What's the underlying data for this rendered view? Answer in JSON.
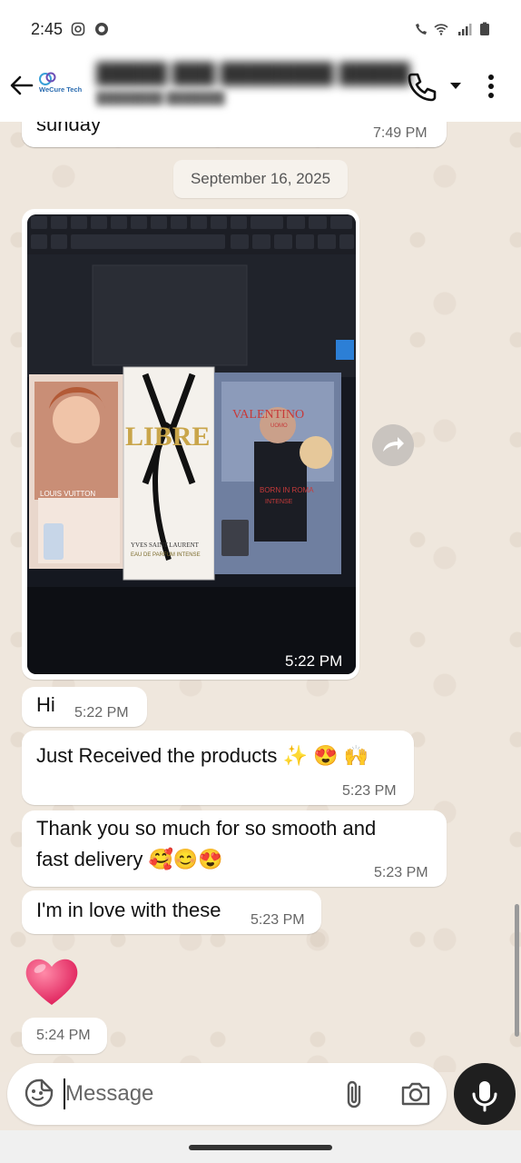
{
  "status_bar": {
    "time": "2:45"
  },
  "header": {
    "avatar_logo_text": "WeCure Tech",
    "contact_name": "█████ ███ ████████ █████",
    "contact_subtitle": "████████ ███████"
  },
  "messages": [
    {
      "text": "sunday",
      "time": "7:49 PM"
    },
    {
      "date_separator": "September 16, 2025"
    },
    {
      "type": "photo",
      "time": "5:22 PM",
      "box_labels": [
        "LOUIS VUITTON",
        "LIBRE",
        "YVES SAINT LAURENT",
        "EAU DE PARFUM INTENSE",
        "VALENTINO",
        "UOMO",
        "BORN IN ROMA",
        "INTENSE"
      ]
    },
    {
      "text": "Hi",
      "time": "5:22 PM"
    },
    {
      "text": "Just Received the products ✨ 😍 🙌",
      "time": "5:23 PM"
    },
    {
      "text_line1": "Thank you so much for so smooth and",
      "text_line2": "fast  delivery 🥰😊😍",
      "time": "5:23 PM"
    },
    {
      "text": "I'm in love with these",
      "time": "5:23 PM"
    },
    {
      "emoji": "heart",
      "time": "5:24 PM"
    }
  ],
  "input": {
    "placeholder": "Message"
  },
  "icons": [
    "back-arrow-icon",
    "phone-icon",
    "chevron-down-icon",
    "more-vert-icon",
    "forward-icon",
    "sticker-icon",
    "paperclip-icon",
    "camera-icon",
    "microphone-icon"
  ],
  "colors": {
    "wallpaper": "#efe7de",
    "bubble": "#ffffff",
    "mic_button": "#1f1f1f"
  }
}
